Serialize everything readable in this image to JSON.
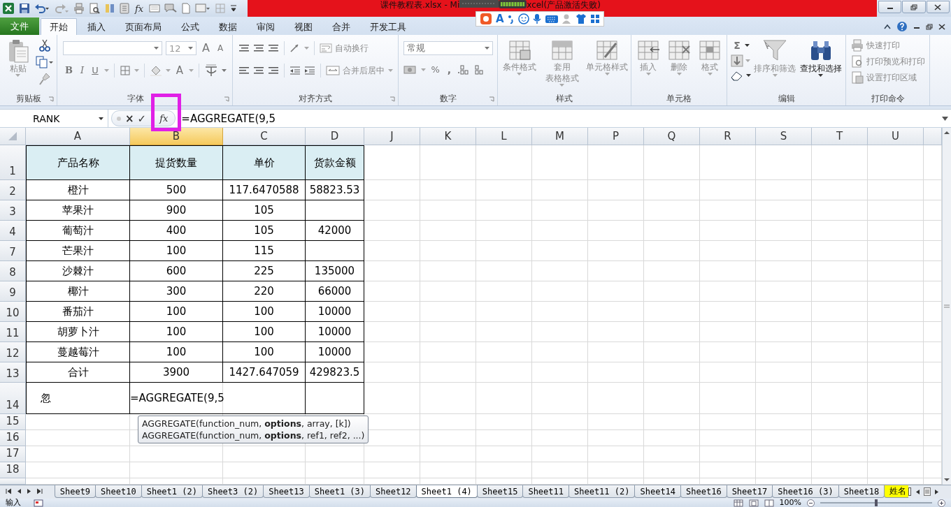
{
  "window": {
    "title_start": "课件教程表.xlsx - Mi",
    "title_end": "xcel(产品激活失败)"
  },
  "quick_access": {
    "insert_function": "fx"
  },
  "ime_toolbar": {
    "font_glyph": "A"
  },
  "ribbon_tabs": [
    {
      "label": "文件",
      "kind": "file",
      "selected": false
    },
    {
      "label": "开始",
      "kind": "tab",
      "selected": true
    },
    {
      "label": "插入",
      "kind": "tab",
      "selected": false
    },
    {
      "label": "页面布局",
      "kind": "tab",
      "selected": false
    },
    {
      "label": "公式",
      "kind": "tab",
      "selected": false
    },
    {
      "label": "数据",
      "kind": "tab",
      "selected": false
    },
    {
      "label": "审阅",
      "kind": "tab",
      "selected": false
    },
    {
      "label": "视图",
      "kind": "tab",
      "selected": false
    },
    {
      "label": "合并",
      "kind": "tab",
      "selected": false
    },
    {
      "label": "开发工具",
      "kind": "tab",
      "selected": false
    }
  ],
  "ribbon": {
    "groups": [
      {
        "kind": "clipboard",
        "label": "剪贴板",
        "items": [
          {
            "label": "粘贴",
            "disabled": true
          }
        ]
      },
      {
        "kind": "font",
        "label": "字体",
        "font_size": "12",
        "grow_font": "A",
        "shrink_font": "A",
        "bold": "B",
        "italic": "I",
        "underline": "U",
        "font_color": "A"
      },
      {
        "kind": "alignment",
        "label": "对齐方式",
        "items": [
          {
            "label": "自动换行",
            "disabled": true
          },
          {
            "label": "合并后居中",
            "disabled": true
          }
        ]
      },
      {
        "kind": "number",
        "label": "数字",
        "format": "常规",
        "percent": "%",
        "comma": ","
      },
      {
        "kind": "styles",
        "label": "样式",
        "items": [
          {
            "label": "条件格式",
            "disabled": true
          },
          {
            "label": "套用",
            "label_2": "表格格式",
            "disabled": true
          },
          {
            "label": "单元格样式",
            "disabled": true
          }
        ]
      },
      {
        "kind": "cells",
        "label": "单元格",
        "items": [
          {
            "label": "插入",
            "disabled": true
          },
          {
            "label": "删除",
            "disabled": true
          },
          {
            "label": "格式",
            "disabled": true
          }
        ]
      },
      {
        "kind": "editing",
        "label": "编辑",
        "sum": "Σ",
        "items": [
          {
            "label": "排序和筛选",
            "disabled": true
          },
          {
            "label": "查找和选择",
            "disabled": false
          }
        ]
      },
      {
        "kind": "print",
        "label": "打印命令",
        "items": [
          {
            "label": "快速打印",
            "disabled": true
          },
          {
            "label": "打印预览和打印",
            "disabled": true
          },
          {
            "label": "设置打印区域",
            "disabled": true
          }
        ]
      }
    ]
  },
  "formula_bar": {
    "name_box": "RANK",
    "cancel": "×",
    "enter": "✓",
    "insert_function": "fx",
    "formula": "=AGGREGATE(9,5"
  },
  "sheet": {
    "columns": [
      {
        "label": "A",
        "selected": false
      },
      {
        "label": "B",
        "selected": true
      },
      {
        "label": "C",
        "selected": false
      },
      {
        "label": "D",
        "selected": false
      },
      {
        "label": "J",
        "selected": false
      },
      {
        "label": "K",
        "selected": false
      },
      {
        "label": "L",
        "selected": false
      },
      {
        "label": "M",
        "selected": false
      },
      {
        "label": "P",
        "selected": false
      },
      {
        "label": "Q",
        "selected": false
      },
      {
        "label": "R",
        "selected": false
      },
      {
        "label": "S",
        "selected": false
      },
      {
        "label": "T",
        "selected": false
      },
      {
        "label": "U",
        "selected": false
      }
    ],
    "rows": [
      {
        "header": "1",
        "kind": "heading",
        "product": "产品名称",
        "quantity": "提货数量",
        "price": "单价",
        "amount": "货款金额"
      },
      {
        "header": "2",
        "kind": "data",
        "product": "橙汁",
        "quantity": "500",
        "price": "117.6470588",
        "amount": "58823.53"
      },
      {
        "header": "3",
        "kind": "data",
        "product": "苹果汁",
        "quantity": "900",
        "price": "105"
      },
      {
        "header": "4",
        "kind": "data",
        "product": "葡萄汁",
        "quantity": "400",
        "price": "105",
        "amount": "42000"
      },
      {
        "header": "7",
        "kind": "data",
        "product": "芒果汁",
        "quantity": "100",
        "price": "115"
      },
      {
        "header": "8",
        "kind": "data",
        "product": "沙棘汁",
        "quantity": "600",
        "price": "225",
        "amount": "135000"
      },
      {
        "header": "9",
        "kind": "data",
        "product": "椰汁",
        "quantity": "300",
        "price": "220",
        "amount": "66000"
      },
      {
        "header": "10",
        "kind": "data",
        "product": "番茄汁",
        "quantity": "100",
        "price": "100",
        "amount": "10000"
      },
      {
        "header": "11",
        "kind": "data",
        "product": "胡萝卜汁",
        "quantity": "100",
        "price": "100",
        "amount": "10000"
      },
      {
        "header": "12",
        "kind": "data",
        "product": "蔓越莓汁",
        "quantity": "100",
        "price": "100",
        "amount": "10000"
      },
      {
        "header": "13",
        "kind": "data",
        "product": "合计",
        "quantity": "3900",
        "price": "1427.647059",
        "amount": "429823.5"
      },
      {
        "header": "14",
        "kind": "input",
        "product": "忽",
        "quantity": "=AGGREGATE(9,5",
        "editing": true
      },
      {
        "header": "15",
        "kind": "blank"
      },
      {
        "header": "16",
        "kind": "blank"
      },
      {
        "header": "17",
        "kind": "blank"
      },
      {
        "header": "18",
        "kind": "blank"
      }
    ]
  },
  "tooltip": {
    "lines": [
      "AGGREGATE(function_num, **options**, array, [k])",
      "AGGREGATE(function_num, **options**, ref1, ref2, ...)"
    ]
  },
  "sheet_tabs": [
    {
      "label": "Sheet9",
      "selected": false
    },
    {
      "label": "Sheet10",
      "selected": false
    },
    {
      "label": "Sheet1 (2)",
      "selected": false
    },
    {
      "label": "Sheet3 (2)",
      "selected": false
    },
    {
      "label": "Sheet13",
      "selected": false
    },
    {
      "label": "Sheet1 (3)",
      "selected": false
    },
    {
      "label": "Sheet12",
      "selected": false
    },
    {
      "label": "Sheet1 (4)",
      "selected": true
    },
    {
      "label": "Sheet15",
      "selected": false
    },
    {
      "label": "Sheet11",
      "selected": false
    },
    {
      "label": "Sheet11 (2)",
      "selected": false
    },
    {
      "label": "Sheet14",
      "selected": false
    },
    {
      "label": "Sheet16",
      "selected": false
    },
    {
      "label": "Sheet17",
      "selected": false
    },
    {
      "label": "Sheet16 (3)",
      "selected": false
    },
    {
      "label": "Sheet18",
      "selected": false
    },
    {
      "label": "姓名",
      "selected": false,
      "color": "#ffff00"
    }
  ],
  "status_bar": {
    "mode": "输入",
    "zoom": "100%",
    "zoom_slider": {
      "level": 0.5
    }
  }
}
